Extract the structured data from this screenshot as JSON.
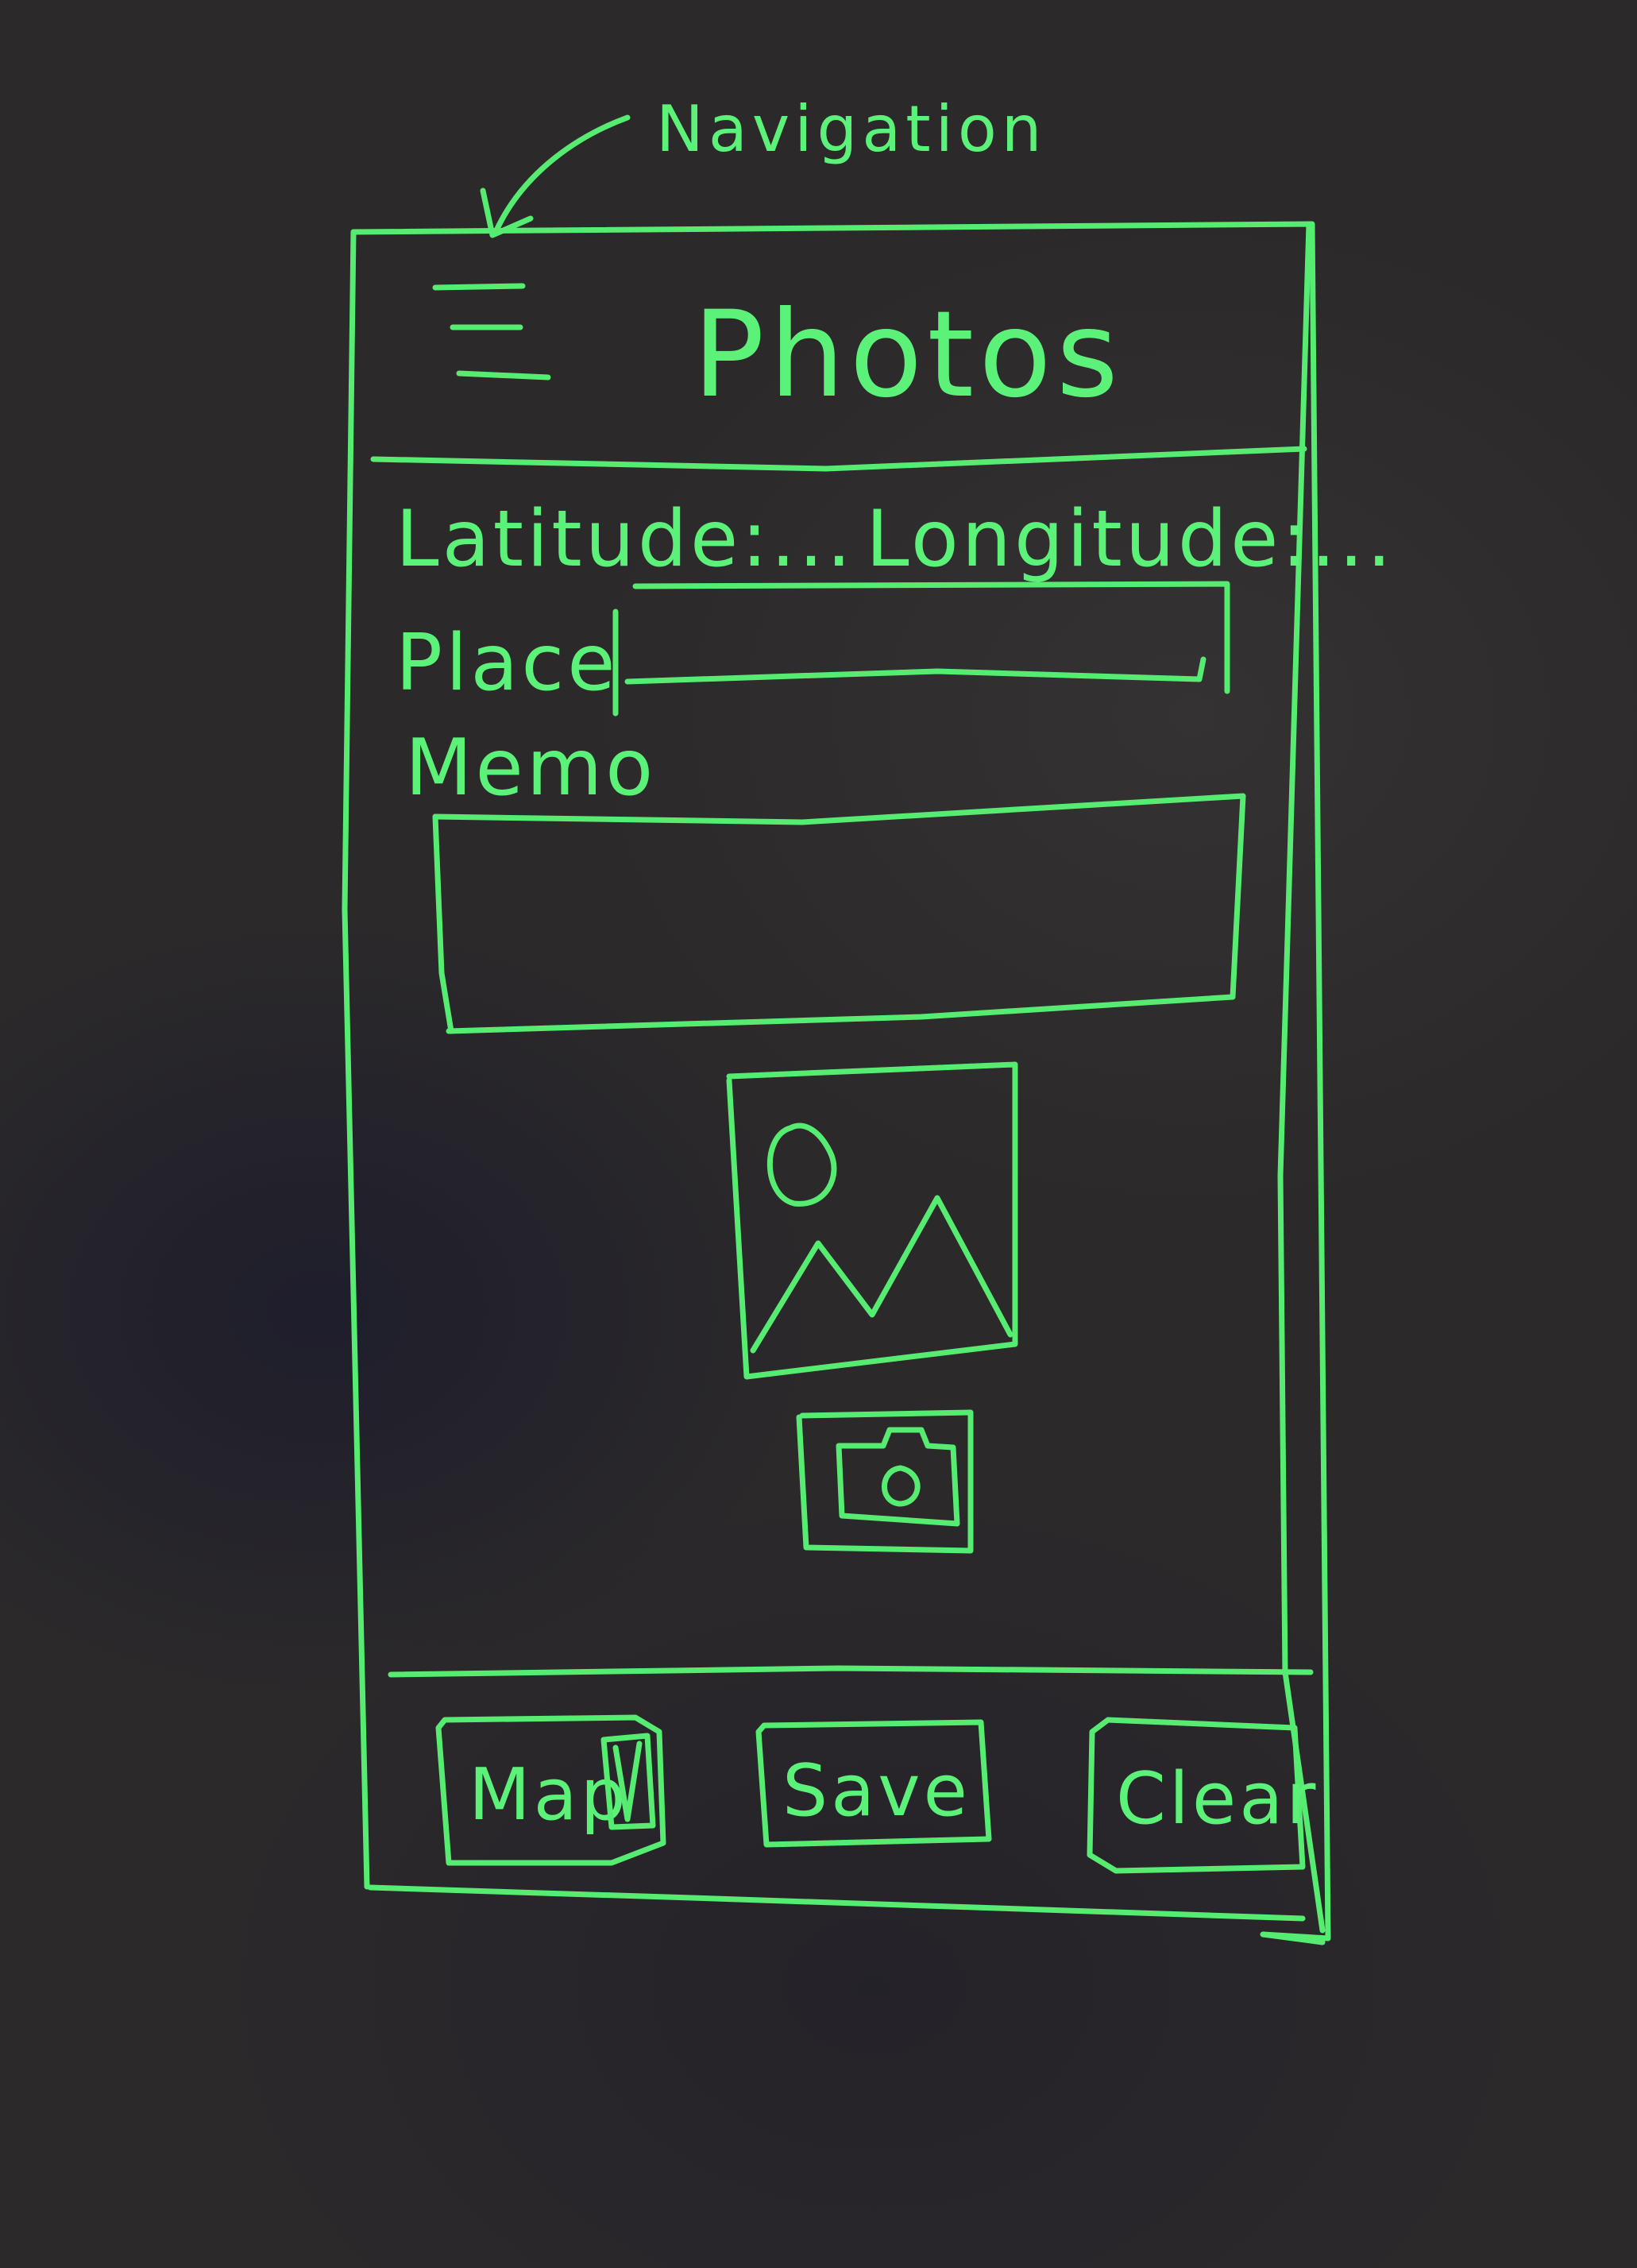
{
  "annotation": {
    "label": "Navigation"
  },
  "header": {
    "title": "Photos",
    "menu_icon": "hamburger-menu-icon"
  },
  "location": {
    "latitude_label": "Latitude:...",
    "longitude_label": "Longitude:..."
  },
  "form": {
    "place_label": "Place",
    "place_value": "",
    "memo_label": "Memo",
    "memo_value": ""
  },
  "media": {
    "image_icon": "image-placeholder-icon",
    "camera_icon": "camera-icon"
  },
  "footer": {
    "map_label": "Map",
    "map_icon": "map-icon",
    "save_label": "Save",
    "clear_label": "Clear"
  },
  "colors": {
    "chalk": "#56ec72",
    "board": "#2b292a"
  }
}
